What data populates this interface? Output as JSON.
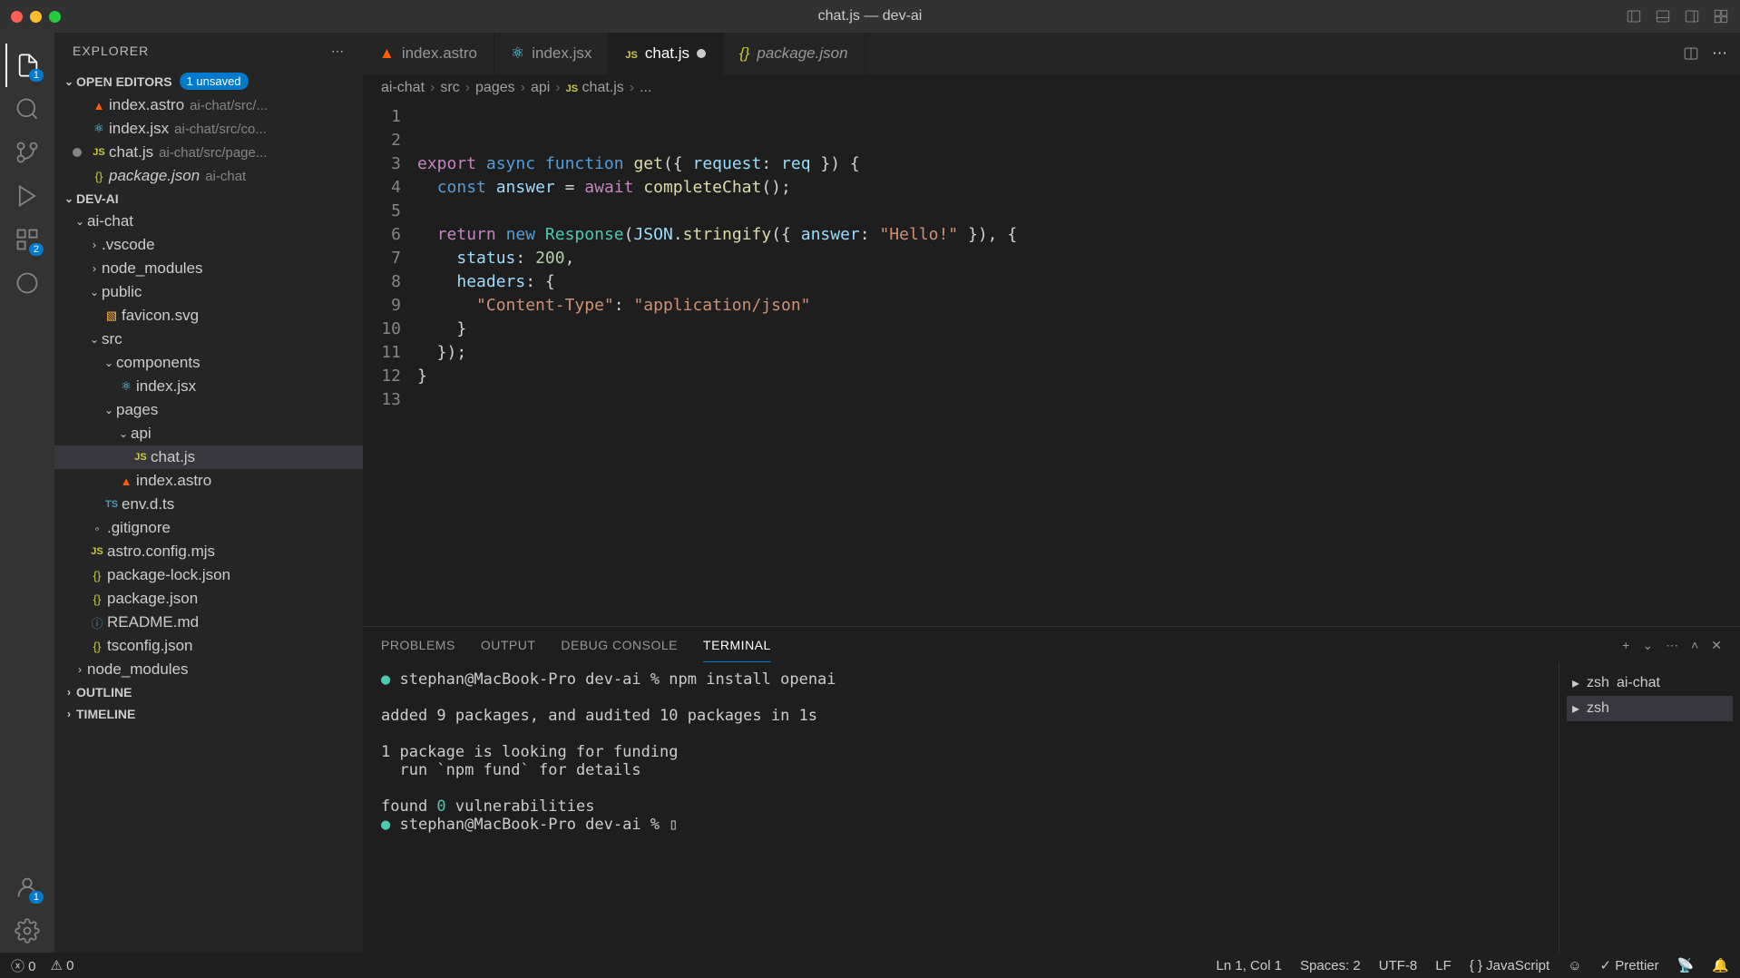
{
  "window": {
    "title": "chat.js — dev-ai"
  },
  "explorer": {
    "title": "EXPLORER",
    "openEditors": {
      "label": "OPEN EDITORS",
      "unsaved": "1 unsaved",
      "items": [
        {
          "name": "index.astro",
          "path": "ai-chat/src/...",
          "icon": "astro"
        },
        {
          "name": "index.jsx",
          "path": "ai-chat/src/co...",
          "icon": "react"
        },
        {
          "name": "chat.js",
          "path": "ai-chat/src/page...",
          "icon": "js",
          "modified": true
        },
        {
          "name": "package.json",
          "path": "ai-chat",
          "icon": "json",
          "italic": true
        }
      ]
    },
    "workspace": {
      "name": "DEV-AI",
      "tree": [
        {
          "name": "ai-chat",
          "type": "folder",
          "depth": 1,
          "open": true
        },
        {
          "name": ".vscode",
          "type": "folder",
          "depth": 2
        },
        {
          "name": "node_modules",
          "type": "folder",
          "depth": 2
        },
        {
          "name": "public",
          "type": "folder",
          "depth": 2,
          "open": true
        },
        {
          "name": "favicon.svg",
          "type": "file",
          "depth": 3,
          "icon": "svg"
        },
        {
          "name": "src",
          "type": "folder",
          "depth": 2,
          "open": true
        },
        {
          "name": "components",
          "type": "folder",
          "depth": 3,
          "open": true
        },
        {
          "name": "index.jsx",
          "type": "file",
          "depth": 4,
          "icon": "react"
        },
        {
          "name": "pages",
          "type": "folder",
          "depth": 3,
          "open": true
        },
        {
          "name": "api",
          "type": "folder",
          "depth": 4,
          "open": true
        },
        {
          "name": "chat.js",
          "type": "file",
          "depth": 5,
          "icon": "js",
          "selected": true
        },
        {
          "name": "index.astro",
          "type": "file",
          "depth": 4,
          "icon": "astro"
        },
        {
          "name": "env.d.ts",
          "type": "file",
          "depth": 3,
          "icon": "ts"
        },
        {
          "name": ".gitignore",
          "type": "file",
          "depth": 2,
          "icon": "git"
        },
        {
          "name": "astro.config.mjs",
          "type": "file",
          "depth": 2,
          "icon": "js"
        },
        {
          "name": "package-lock.json",
          "type": "file",
          "depth": 2,
          "icon": "json"
        },
        {
          "name": "package.json",
          "type": "file",
          "depth": 2,
          "icon": "json"
        },
        {
          "name": "README.md",
          "type": "file",
          "depth": 2,
          "icon": "info"
        },
        {
          "name": "tsconfig.json",
          "type": "file",
          "depth": 2,
          "icon": "json"
        },
        {
          "name": "node_modules",
          "type": "folder",
          "depth": 1
        }
      ]
    },
    "outline": "OUTLINE",
    "timeline": "TIMELINE"
  },
  "tabs": [
    {
      "name": "index.astro",
      "icon": "astro"
    },
    {
      "name": "index.jsx",
      "icon": "react"
    },
    {
      "name": "chat.js",
      "icon": "js",
      "active": true,
      "modified": true
    },
    {
      "name": "package.json",
      "icon": "json",
      "italic": true
    }
  ],
  "breadcrumb": [
    "ai-chat",
    "src",
    "pages",
    "api",
    "chat.js",
    "..."
  ],
  "code": {
    "lines": [
      {
        "n": 1,
        "html": ""
      },
      {
        "n": 2,
        "html": ""
      },
      {
        "n": 3,
        "html": "<span class='k-keyword'>export</span> <span class='k-key2'>async</span> <span class='k-key2'>function</span> <span class='k-func'>get</span>({ <span class='k-var'>request</span>: <span class='k-var'>req</span> }) {"
      },
      {
        "n": 4,
        "html": "  <span class='k-key2'>const</span> <span class='k-var'>answer</span> = <span class='k-keyword'>await</span> <span class='k-func'>completeChat</span>();"
      },
      {
        "n": 5,
        "html": ""
      },
      {
        "n": 6,
        "html": "  <span class='k-keyword'>return</span> <span class='k-key2'>new</span> <span class='k-type'>Response</span>(<span class='k-var'>JSON</span>.<span class='k-func'>stringify</span>({ <span class='k-var'>answer</span>: <span class='k-str'>\"Hello!\"</span> }), {"
      },
      {
        "n": 7,
        "html": "    <span class='k-var'>status</span>: <span class='k-num'>200</span>,"
      },
      {
        "n": 8,
        "html": "    <span class='k-var'>headers</span>: {"
      },
      {
        "n": 9,
        "html": "      <span class='k-str'>\"Content-Type\"</span>: <span class='k-str'>\"application/json\"</span>"
      },
      {
        "n": 10,
        "html": "    }"
      },
      {
        "n": 11,
        "html": "  });"
      },
      {
        "n": 12,
        "html": "}"
      },
      {
        "n": 13,
        "html": ""
      }
    ]
  },
  "panel": {
    "tabs": {
      "problems": "PROBLEMS",
      "output": "OUTPUT",
      "debug": "DEBUG CONSOLE",
      "terminal": "TERMINAL"
    },
    "terminal": {
      "lines": [
        "● stephan@MacBook-Pro dev-ai % npm install openai",
        "",
        "added 9 packages, and audited 10 packages in 1s",
        "",
        "1 package is looking for funding",
        "  run `npm fund` for details",
        "",
        "found 0 vulnerabilities",
        "● stephan@MacBook-Pro dev-ai % ▯"
      ],
      "sessions": [
        {
          "name": "zsh",
          "detail": "ai-chat"
        },
        {
          "name": "zsh",
          "detail": "",
          "active": true
        }
      ]
    }
  },
  "statusbar": {
    "errors": "0",
    "warnings": "0",
    "cursor": "Ln 1, Col 1",
    "spaces": "Spaces: 2",
    "encoding": "UTF-8",
    "eol": "LF",
    "lang": "JavaScript",
    "prettier": "Prettier"
  },
  "activity": {
    "explorer_badge": "1",
    "extensions_badge": "2",
    "account_badge": "1"
  }
}
